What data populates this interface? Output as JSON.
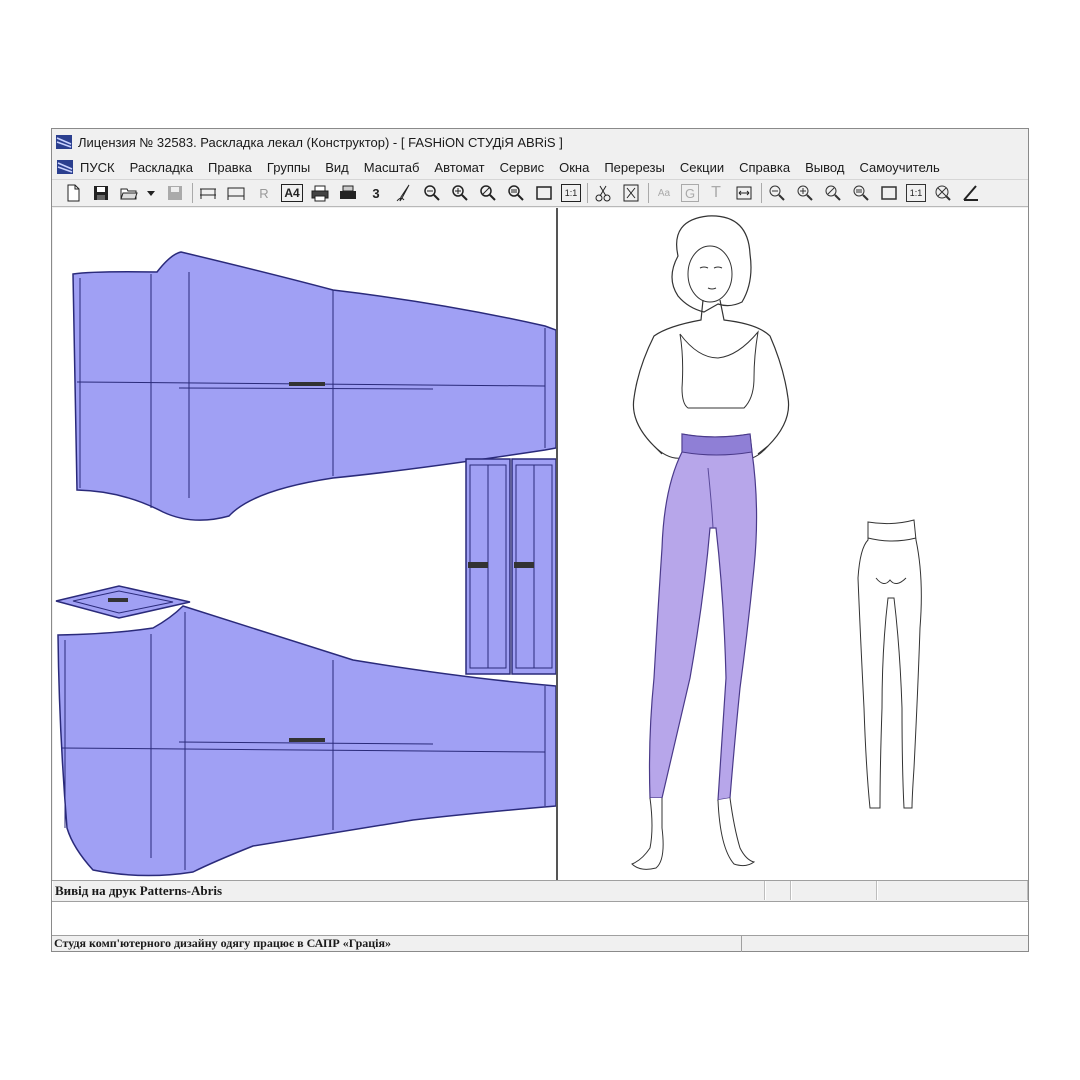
{
  "window": {
    "title": "Лицензия № 32583. Раскладка лекал (Конструктор) - [  FASHiON СТУДіЯ ABRiS  ]"
  },
  "menu": {
    "items": [
      "ПУСК",
      "Раскладка",
      "Правка",
      "Группы",
      "Вид",
      "Масштаб",
      "Автомат",
      "Сервис",
      "Окна",
      "Перерезы",
      "Секции",
      "Справка",
      "Вывод",
      "Самоучитель"
    ]
  },
  "toolbar": {
    "buttons": [
      "new-icon",
      "save-disk-icon",
      "open-folder-icon",
      "dropdown-arrow-icon",
      "save-gray-icon",
      "bed-icon",
      "bed2-icon",
      "r-icon",
      "a4-icon",
      "printer-icon",
      "printer2-icon",
      "digit3-icon",
      "pen-icon",
      "zoom-out-icon",
      "zoom-in-icon",
      "zoom-icon",
      "zoom-fit-icon",
      "rect-icon",
      "one-to-one-icon",
      "scissors-icon",
      "cut-icon",
      "text-aa-icon",
      "g-icon",
      "t-icon",
      "fit-width-icon",
      "zoom-out2-icon",
      "zoom-in2-icon",
      "zoom2-icon",
      "zoom-fit2-icon",
      "rect2-icon",
      "one-to-one2-icon",
      "zoom-x-icon",
      "angle-icon"
    ],
    "labels": {
      "r": "R",
      "a4": "A4",
      "three": "3",
      "one": "1:1",
      "g": "G",
      "t": "T"
    }
  },
  "colors": {
    "pattern_fill": "#a0a0f4",
    "pattern_stroke": "#2a2a7a",
    "legging_fill": "#b7a6ea"
  },
  "status": {
    "line1": "Вивід на друк Patterns-Abris",
    "line2": "Студя  комп'ютерного дизайну одягу працює в САПР «Грація»"
  }
}
